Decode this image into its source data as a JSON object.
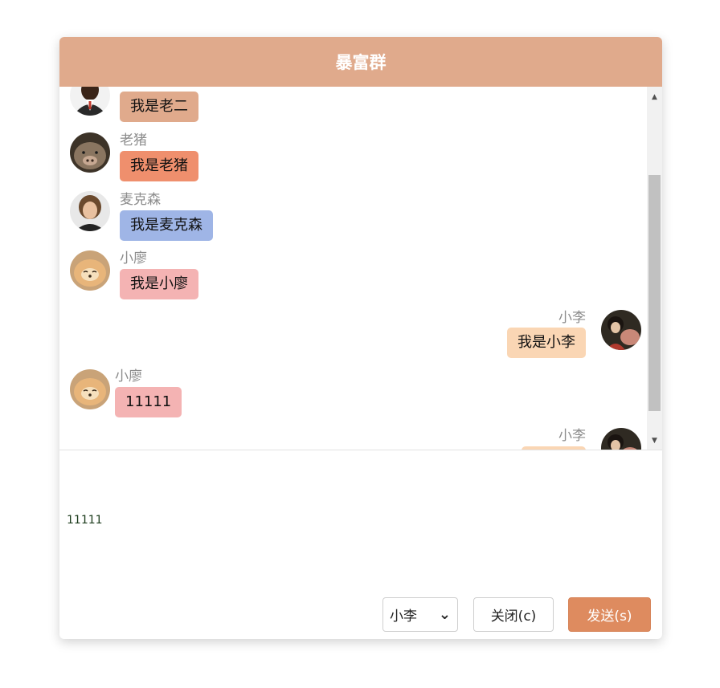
{
  "header": {
    "title": "暴富群"
  },
  "messages": [
    {
      "sender": "",
      "text": "我是老二",
      "side": "left",
      "color": "#e0aa8c"
    },
    {
      "sender": "老猪",
      "text": "我是老猪",
      "side": "left",
      "color": "#ef8f6d"
    },
    {
      "sender": "麦克森",
      "text": "我是麦克森",
      "side": "left",
      "color": "#9fb5e6"
    },
    {
      "sender": "小廖",
      "text": "我是小廖",
      "side": "left",
      "color": "#f4b3b3"
    },
    {
      "sender": "小李",
      "text": "我是小李",
      "side": "right",
      "color": "#fad6b4"
    },
    {
      "sender": "小廖",
      "text": "11111",
      "side": "left",
      "color": "#f4b3b3"
    },
    {
      "sender": "小李",
      "text": "",
      "side": "right",
      "color": "#fad6b4"
    }
  ],
  "composer": {
    "draft": "11111",
    "user_select": {
      "selected": "小李",
      "chevron": "⌄"
    },
    "close_label": "关闭(c)",
    "send_label": "发送(s)"
  },
  "icons": {
    "scroll_up": "▲",
    "scroll_down": "▼"
  }
}
